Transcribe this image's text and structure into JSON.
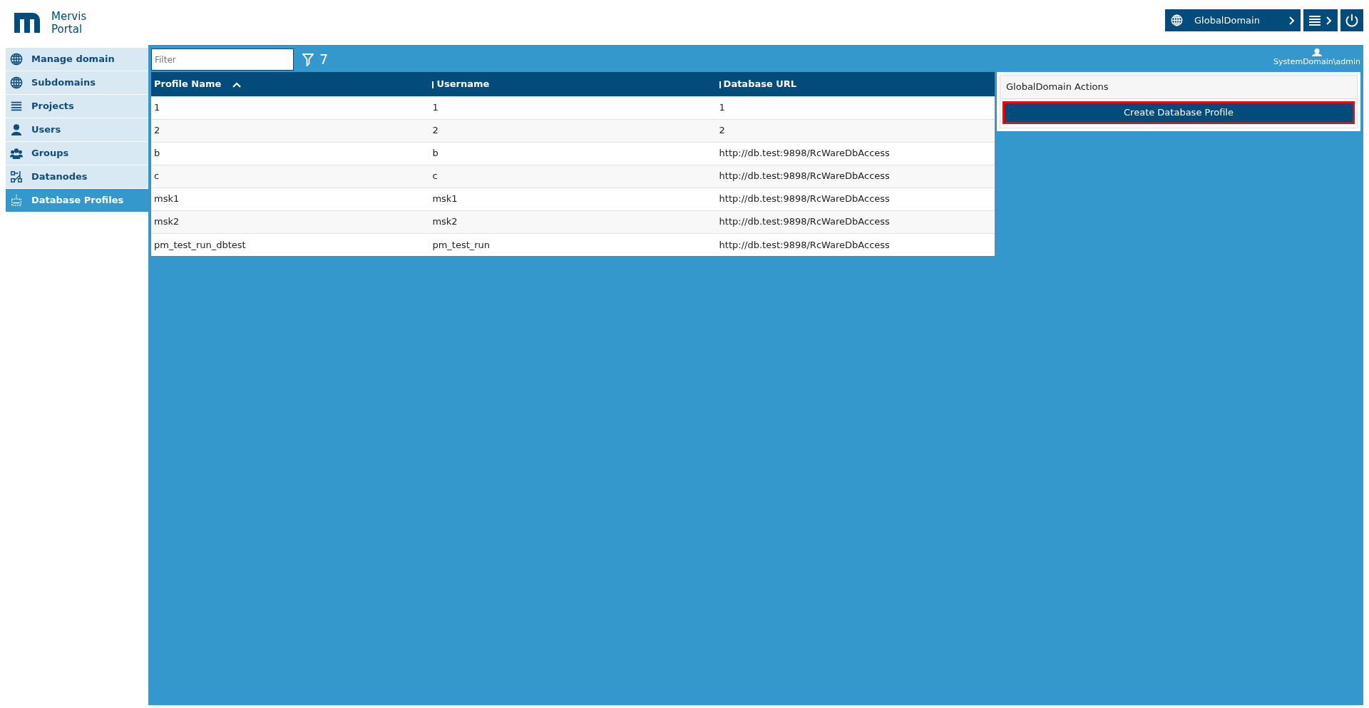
{
  "app": {
    "title_line1": "Mervis",
    "title_line2": "Portal"
  },
  "topbar": {
    "domain": "GlobalDomain",
    "user": "SystemDomain\\admin"
  },
  "sidebar": {
    "items": [
      {
        "label": "Manage domain",
        "selected": false
      },
      {
        "label": "Subdomains",
        "selected": false
      },
      {
        "label": "Projects",
        "selected": false
      },
      {
        "label": "Users",
        "selected": false
      },
      {
        "label": "Groups",
        "selected": false
      },
      {
        "label": "Datanodes",
        "selected": false
      },
      {
        "label": "Database Profiles",
        "selected": true
      }
    ]
  },
  "filter": {
    "placeholder": "Filter",
    "count": "7"
  },
  "table": {
    "columns": [
      {
        "label": "Profile Name",
        "sorted": true
      },
      {
        "label": "Username",
        "sorted": false
      },
      {
        "label": "Database URL",
        "sorted": false
      }
    ],
    "rows": [
      [
        "1",
        "1",
        "1"
      ],
      [
        "2",
        "2",
        "2"
      ],
      [
        "b",
        "b",
        "http://db.test:9898/RcWareDbAccess"
      ],
      [
        "c",
        "c",
        "http://db.test:9898/RcWareDbAccess"
      ],
      [
        "msk1",
        "msk1",
        "http://db.test:9898/RcWareDbAccess"
      ],
      [
        "msk2",
        "msk2",
        "http://db.test:9898/RcWareDbAccess"
      ],
      [
        "pm_test_run_dbtest",
        "pm_test_run",
        "http://db.test:9898/RcWareDbAccess"
      ]
    ]
  },
  "actions": {
    "title": "GlobalDomain Actions",
    "buttons": [
      {
        "label": "Create Database Profile",
        "highlighted": true
      }
    ]
  }
}
